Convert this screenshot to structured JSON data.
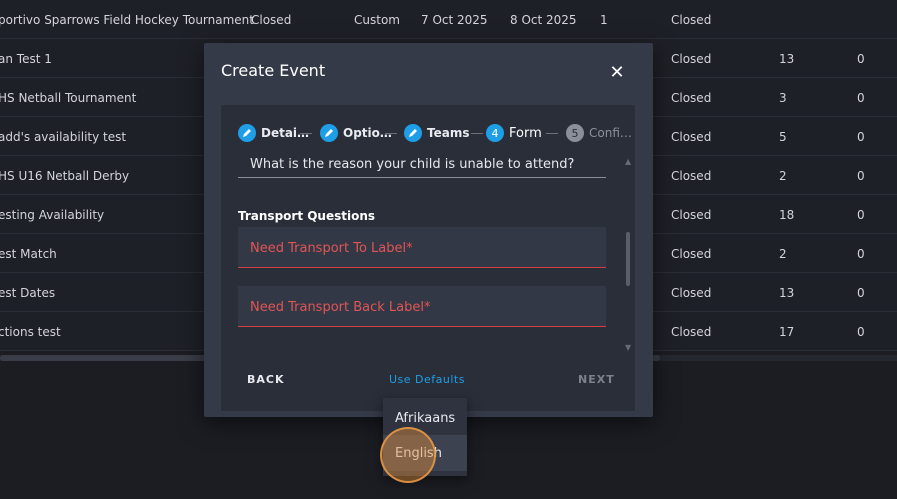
{
  "table": {
    "rows": [
      {
        "name": "portivo Sparrows Field Hockey Tournament",
        "status": "Closed",
        "type": "Custom",
        "start": "7 Oct 2025",
        "end": "8 Oct 2025",
        "num": "1",
        "status2": "Closed",
        "n1": "",
        "n2": ""
      },
      {
        "name": "an Test 1",
        "status": "",
        "type": "",
        "start": "",
        "end": "",
        "num": "",
        "status2": "Closed",
        "n1": "13",
        "n2": "0"
      },
      {
        "name": "HS Netball Tournament",
        "status": "",
        "type": "",
        "start": "",
        "end": "",
        "num": "",
        "status2": "Closed",
        "n1": "3",
        "n2": "0"
      },
      {
        "name": "add's availability test",
        "status": "",
        "type": "",
        "start": "",
        "end": "",
        "num": "",
        "status2": "Closed",
        "n1": "5",
        "n2": "0"
      },
      {
        "name": "HS U16 Netball Derby",
        "status": "",
        "type": "",
        "start": "",
        "end": "",
        "num": "",
        "status2": "Closed",
        "n1": "2",
        "n2": "0"
      },
      {
        "name": "esting Availability",
        "status": "",
        "type": "",
        "start": "",
        "end": "",
        "num": "",
        "status2": "Closed",
        "n1": "18",
        "n2": "0"
      },
      {
        "name": "est Match",
        "status": "",
        "type": "",
        "start": "",
        "end": "",
        "num": "",
        "status2": "Closed",
        "n1": "2",
        "n2": "0"
      },
      {
        "name": "est Dates",
        "status": "",
        "type": "",
        "start": "",
        "end": "",
        "num": "",
        "status2": "Closed",
        "n1": "13",
        "n2": "0"
      },
      {
        "name": "ctions test",
        "status": "",
        "type": "",
        "start": "",
        "end": "",
        "num": "",
        "status2": "Closed",
        "n1": "17",
        "n2": "0"
      }
    ]
  },
  "modal": {
    "title": "Create Event",
    "close_icon": "close-icon",
    "steps": [
      {
        "number": "",
        "label": "Detai…",
        "state": "done",
        "icon": "pencil-icon"
      },
      {
        "number": "",
        "label": "Optio…",
        "state": "done",
        "icon": "pencil-icon"
      },
      {
        "number": "",
        "label": "Teams",
        "state": "done",
        "icon": "pencil-icon"
      },
      {
        "number": "4",
        "label": "Form",
        "state": "active"
      },
      {
        "number": "5",
        "label": "Confi…",
        "state": "inactive"
      }
    ],
    "question_text": "What is the reason your child is unable to attend?",
    "section_label": "Transport Questions",
    "fields": [
      {
        "label": "Need Transport To Label*"
      },
      {
        "label": "Need Transport Back Label*"
      }
    ],
    "back_label": "BACK",
    "defaults_label": "Use Defaults",
    "next_label": "NEXT"
  },
  "dropdown": {
    "options": [
      "Afrikaans",
      "English"
    ],
    "hovered": "English"
  },
  "colors": {
    "accent": "#1e9ee6",
    "error": "#e05555",
    "background": "#1b1d23",
    "modal": "#353a48"
  }
}
